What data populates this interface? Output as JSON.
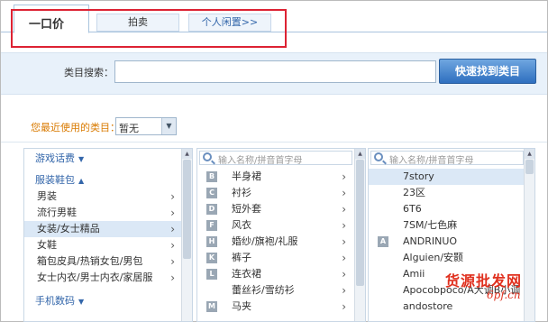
{
  "tabs": {
    "active": "一口价",
    "auction": "拍卖",
    "personal": "个人闲置>>"
  },
  "search": {
    "label": "类目搜索：",
    "value": "",
    "button": "快速找到类目"
  },
  "recent": {
    "label": "您最近使用的类目：",
    "value": "暂无"
  },
  "panel1": {
    "group1": "游戏话费",
    "group2": "服装鞋包",
    "items": [
      "男装",
      "流行男鞋",
      "女装/女士精品",
      "女鞋",
      "箱包皮具/热销女包/男包",
      "女士内衣/男士内衣/家居服"
    ],
    "group3": "手机数码"
  },
  "panel2": {
    "placeholder": "输入名称/拼音首字母",
    "rows": [
      {
        "letter": "B",
        "text": "半身裙"
      },
      {
        "letter": "C",
        "text": "衬衫"
      },
      {
        "letter": "D",
        "text": "短外套"
      },
      {
        "letter": "F",
        "text": "风衣"
      },
      {
        "letter": "H",
        "text": "婚纱/旗袍/礼服"
      },
      {
        "letter": "K",
        "text": "裤子"
      },
      {
        "letter": "L",
        "text": "连衣裙"
      },
      {
        "letter": "",
        "text": "蕾丝衫/雪纺衫"
      },
      {
        "letter": "M",
        "text": "马夹"
      }
    ]
  },
  "panel3": {
    "placeholder": "输入名称/拼音首字母",
    "rows": [
      {
        "letter": "",
        "text": "7story"
      },
      {
        "letter": "",
        "text": "23区"
      },
      {
        "letter": "",
        "text": "6T6"
      },
      {
        "letter": "",
        "text": "7SM/七色麻"
      },
      {
        "letter": "A",
        "text": "ANDRINUO"
      },
      {
        "letter": "",
        "text": "Alguien/安颢"
      },
      {
        "letter": "",
        "text": "Amii"
      },
      {
        "letter": "",
        "text": "Apocobpoco/A大调B小调"
      },
      {
        "letter": "",
        "text": "andostore"
      }
    ]
  },
  "watermark": {
    "line1": "货源批发网",
    "line2": "6pf.cn"
  }
}
